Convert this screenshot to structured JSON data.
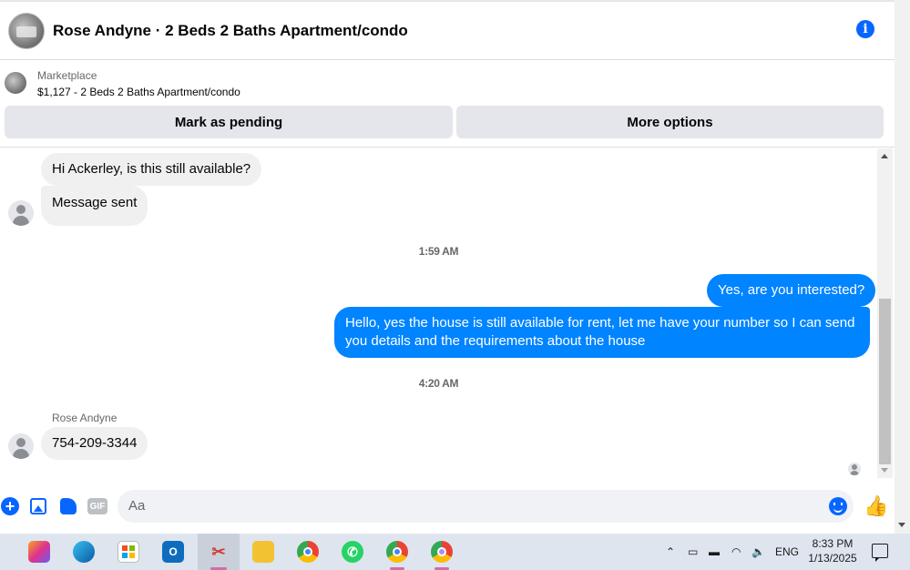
{
  "header": {
    "title": "Rose Andyne · 2 Beds 2 Baths Apartment/condo"
  },
  "marketplace": {
    "label": "Marketplace",
    "listing": "$1,127 - 2 Beds 2 Baths Apartment/condo",
    "pending_button": "Mark as pending",
    "more_button": "More options"
  },
  "messages": [
    {
      "direction": "outgoing-self",
      "text": "Hi Ackerley, is this still available?"
    },
    {
      "direction": "outgoing-self",
      "text": "Message sent"
    },
    {
      "time": "1:59 AM"
    },
    {
      "direction": "incoming",
      "text": "Yes, are you interested?"
    },
    {
      "direction": "incoming",
      "text": "Hello, yes the house is still available for rent, let me have your number so I can send you details and the requirements about the house"
    },
    {
      "time": "4:20 AM"
    },
    {
      "sender": "Rose Andyne",
      "text": "754-209-3344"
    }
  ],
  "composer": {
    "placeholder": "Aa"
  },
  "taskbar": {
    "language": "ENG",
    "time": "8:33 PM",
    "date": "1/13/2025"
  },
  "colors": {
    "accent": "#0866ff",
    "outgoing_bubble": "#0084ff",
    "incoming_bubble": "#f0f0f0"
  }
}
